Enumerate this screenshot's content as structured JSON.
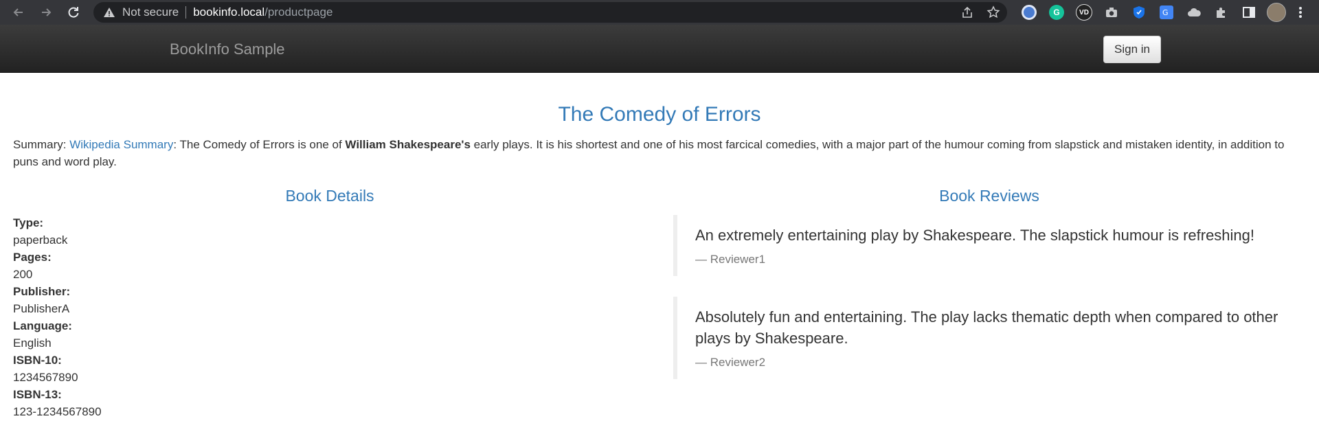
{
  "browser": {
    "not_secure": "Not secure",
    "url_host": "bookinfo.local",
    "url_path": "/productpage",
    "colors": {
      "chrome_bg": "#35363a",
      "omnibox_bg": "#202124"
    },
    "extensions": [
      "extension-1-icon",
      "grammarly-icon",
      "vidiq-icon",
      "camera-icon",
      "shield-extension-icon",
      "translate-icon",
      "cloud-extension-icon",
      "puzzle-icon",
      "side-panel-icon",
      "profile-avatar"
    ]
  },
  "navbar": {
    "brand": "BookInfo Sample",
    "signin_label": "Sign in"
  },
  "product": {
    "title": "The Comedy of Errors",
    "summary_prefix": "Summary: ",
    "summary_link": "Wikipedia Summary",
    "summary_mid": ": The Comedy of Errors is one of ",
    "summary_bold": "William Shakespeare's",
    "summary_rest": " early plays. It is his shortest and one of his most farcical comedies, with a major part of the humour coming from slapstick and mistaken identity, in addition to puns and word play."
  },
  "details": {
    "heading": "Book Details",
    "items": [
      {
        "label": "Type:",
        "value": "paperback"
      },
      {
        "label": "Pages:",
        "value": "200"
      },
      {
        "label": "Publisher:",
        "value": "PublisherA"
      },
      {
        "label": "Language:",
        "value": "English"
      },
      {
        "label": "ISBN-10:",
        "value": "1234567890"
      },
      {
        "label": "ISBN-13:",
        "value": "123-1234567890"
      }
    ]
  },
  "reviews": {
    "heading": "Book Reviews",
    "items": [
      {
        "text": "An extremely entertaining play by Shakespeare. The slapstick humour is refreshing!",
        "reviewer": "— Reviewer1"
      },
      {
        "text": "Absolutely fun and entertaining. The play lacks thematic depth when compared to other plays by Shakespeare.",
        "reviewer": "— Reviewer2"
      }
    ]
  }
}
